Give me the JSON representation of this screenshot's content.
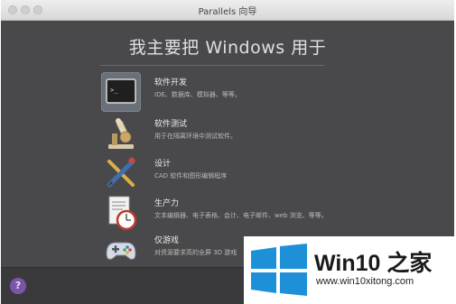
{
  "window": {
    "title": "Parallels 向导"
  },
  "heading": "我主要把 Windows 用于",
  "options": [
    {
      "title": "软件开发",
      "desc": "IDE、数据库、模拟器、等等。",
      "icon": "terminal-icon"
    },
    {
      "title": "软件测试",
      "desc": "用于在隔离环境中测试软件。",
      "icon": "microscope-icon"
    },
    {
      "title": "设计",
      "desc": "CAD 软件和图形编辑程序",
      "icon": "design-tools-icon"
    },
    {
      "title": "生产力",
      "desc": "文本编辑器、电子表格、会计、电子邮件、web 浏览、等等。",
      "icon": "document-clock-icon"
    },
    {
      "title": "仅游戏",
      "desc": "对资源要求高的全屏 3D 游戏",
      "icon": "gamepad-icon"
    }
  ],
  "help": {
    "label": "?"
  },
  "watermark": {
    "brand": "Win10 之家",
    "url": "www.win10xitong.com"
  },
  "colors": {
    "window_bg": "#49494b",
    "selected_bg": "#6a7078",
    "help_purple": "#7a55a8",
    "win_blue": "#1e90d8"
  }
}
